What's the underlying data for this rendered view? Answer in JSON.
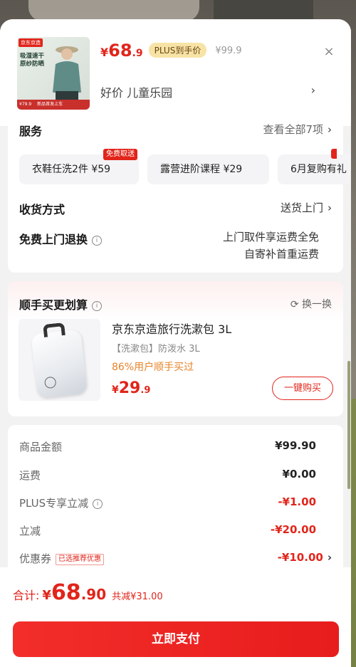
{
  "header": {
    "thumb": {
      "badge": "京东京造",
      "text_line1": "吸湿速干",
      "text_line2": "原纱防晒",
      "bottom_text": "¥79.9",
      "bottom_promo": "新品首发上车"
    },
    "price_currency": "¥",
    "price_integer": "68",
    "price_decimal": ".9",
    "plus_badge": "PLUS到手价",
    "original_price": "¥99.9",
    "close_icon": "×",
    "spec_text": "好价  儿童乐园",
    "spec_arrow": "›"
  },
  "services": {
    "title": "服务",
    "view_all": "查看全部7项",
    "chev": "›",
    "chips": [
      {
        "label": "衣鞋任洗2件  ¥59",
        "badge": "免费取送"
      },
      {
        "label": "露营进阶课程  ¥29",
        "badge": ""
      },
      {
        "label": "6月复购有礼",
        "badge": ""
      }
    ],
    "delivery_label": "收货方式",
    "delivery_value": "送货上门",
    "return_label": "免费上门退换",
    "return_info_icon": "i",
    "return_line1": "上门取件享运费全免",
    "return_line2": "自寄补首重运费"
  },
  "addon": {
    "title": "顺手买更划算",
    "info_icon": "i",
    "refresh_label": "换一换",
    "refresh_icon": "⟳",
    "product_title": "京东京造旅行洗漱包 3L",
    "product_sub": "【洗漱包】防泼水 3L",
    "product_pct": "86%用户顺手买过",
    "price_currency": "¥",
    "price_integer": "29",
    "price_decimal": ".9",
    "buy_label": "一键购买"
  },
  "fees": {
    "goods_label": "商品金额",
    "goods_value": "¥99.90",
    "shipping_label": "运费",
    "shipping_value": "¥0.00",
    "plus_label": "PLUS专享立减",
    "plus_value": "-¥1.00",
    "discount_label": "立减",
    "discount_value": "-¥20.00",
    "coupon_label": "优惠券",
    "coupon_tag": "已选推荐优惠",
    "coupon_value": "-¥10.00"
  },
  "footer": {
    "total_label": "合计:",
    "currency": "¥",
    "total_integer": "68",
    "total_decimal": ".90",
    "savings": "共减¥31.00",
    "pay_label": "立即支付"
  },
  "colors": {
    "accent": "#e1251b",
    "plus_badge_bg": "#f7e3a6",
    "orange": "#e6842a"
  }
}
